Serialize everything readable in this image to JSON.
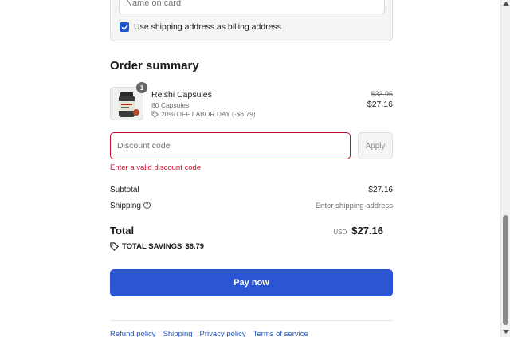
{
  "payment": {
    "name_placeholder": "Name on card",
    "billing_same_label": "Use shipping address as billing address",
    "billing_same_checked": true
  },
  "order_summary": {
    "title": "Order summary",
    "product": {
      "quantity": "1",
      "name": "Reishi Capsules",
      "variant": "60 Capsules",
      "discount_label": "20% OFF LABOR DAY (-$6.79)",
      "original_price": "$33.95",
      "price": "$27.16"
    },
    "discount": {
      "placeholder": "Discount code",
      "apply_label": "Apply",
      "error": "Enter a valid discount code"
    },
    "subtotal_label": "Subtotal",
    "subtotal_value": "$27.16",
    "shipping_label": "Shipping",
    "shipping_value": "Enter shipping address",
    "total_label": "Total",
    "total_currency": "USD",
    "total_value": "$27.16",
    "savings_label": "TOTAL SAVINGS",
    "savings_value": "$6.79",
    "pay_label": "Pay now"
  },
  "footer": {
    "links": [
      "Refund policy",
      "Shipping",
      "Privacy policy",
      "Terms of service"
    ]
  },
  "colors": {
    "accent": "#2c55d3",
    "error": "#c8102e",
    "link": "#2156c9"
  }
}
